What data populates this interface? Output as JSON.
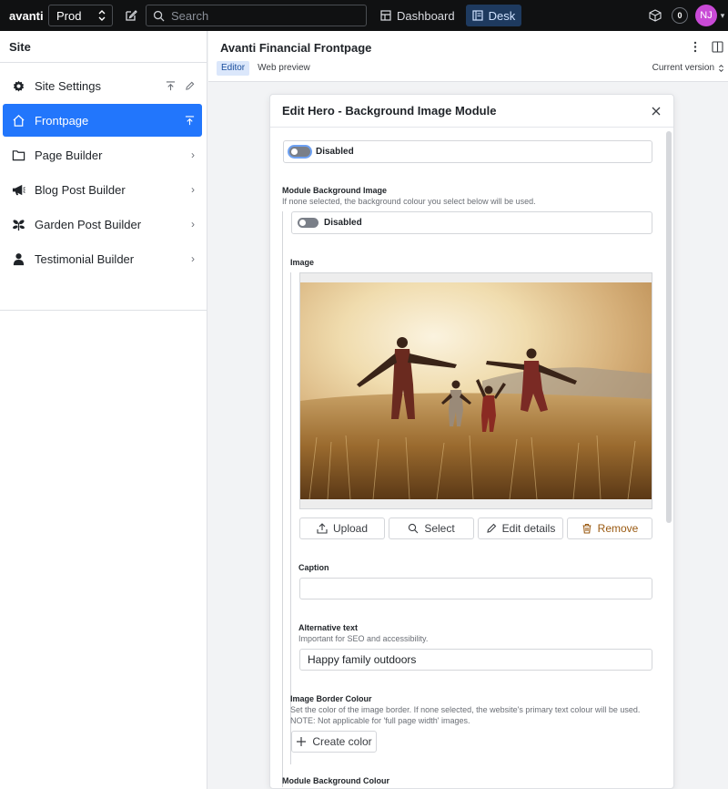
{
  "topbar": {
    "brand": "avanti",
    "environment": "Prod",
    "search_placeholder": "Search",
    "nav": [
      {
        "label": "Dashboard",
        "active": false
      },
      {
        "label": "Desk",
        "active": true
      }
    ],
    "notifications_count": "0",
    "avatar_initials": "NJ"
  },
  "sidebar": {
    "title": "Site",
    "items": [
      {
        "label": "Site Settings",
        "icon": "gear-icon",
        "active": false
      },
      {
        "label": "Frontpage",
        "icon": "home-icon",
        "active": true
      },
      {
        "label": "Page Builder",
        "icon": "folder-icon",
        "active": false
      },
      {
        "label": "Blog Post Builder",
        "icon": "megaphone-icon",
        "active": false
      },
      {
        "label": "Garden Post Builder",
        "icon": "plant-icon",
        "active": false
      },
      {
        "label": "Testimonial Builder",
        "icon": "user-icon",
        "active": false
      }
    ]
  },
  "document": {
    "title": "Avanti Financial Frontpage",
    "tabs": [
      {
        "label": "Editor",
        "active": true
      },
      {
        "label": "Web preview",
        "active": false
      }
    ],
    "version_label": "Current version"
  },
  "dialog": {
    "title": "Edit Hero - Background Image Module",
    "top_toggle_label": "Disabled",
    "module_bg_image": {
      "label": "Module Background Image",
      "description": "If none selected, the background colour you select below will be used.",
      "toggle_label": "Disabled"
    },
    "image": {
      "label": "Image",
      "buttons": {
        "upload": "Upload",
        "select": "Select",
        "edit": "Edit details",
        "remove": "Remove"
      }
    },
    "caption": {
      "label": "Caption",
      "value": ""
    },
    "alt_text": {
      "label": "Alternative text",
      "description": "Important for SEO and accessibility.",
      "value": "Happy family outdoors"
    },
    "border_colour": {
      "label": "Image Border Colour",
      "description": "Set the color of the image border. If none selected, the website's primary text colour will be used. NOTE: Not applicable for 'full page width' images.",
      "button": "Create color"
    },
    "module_bg_colour": {
      "label": "Module Background Colour"
    }
  },
  "colors": {
    "accent": "#2276fc",
    "topbar": "#101112",
    "avatar": "#c94ad6",
    "danger": "#9a5a12"
  }
}
